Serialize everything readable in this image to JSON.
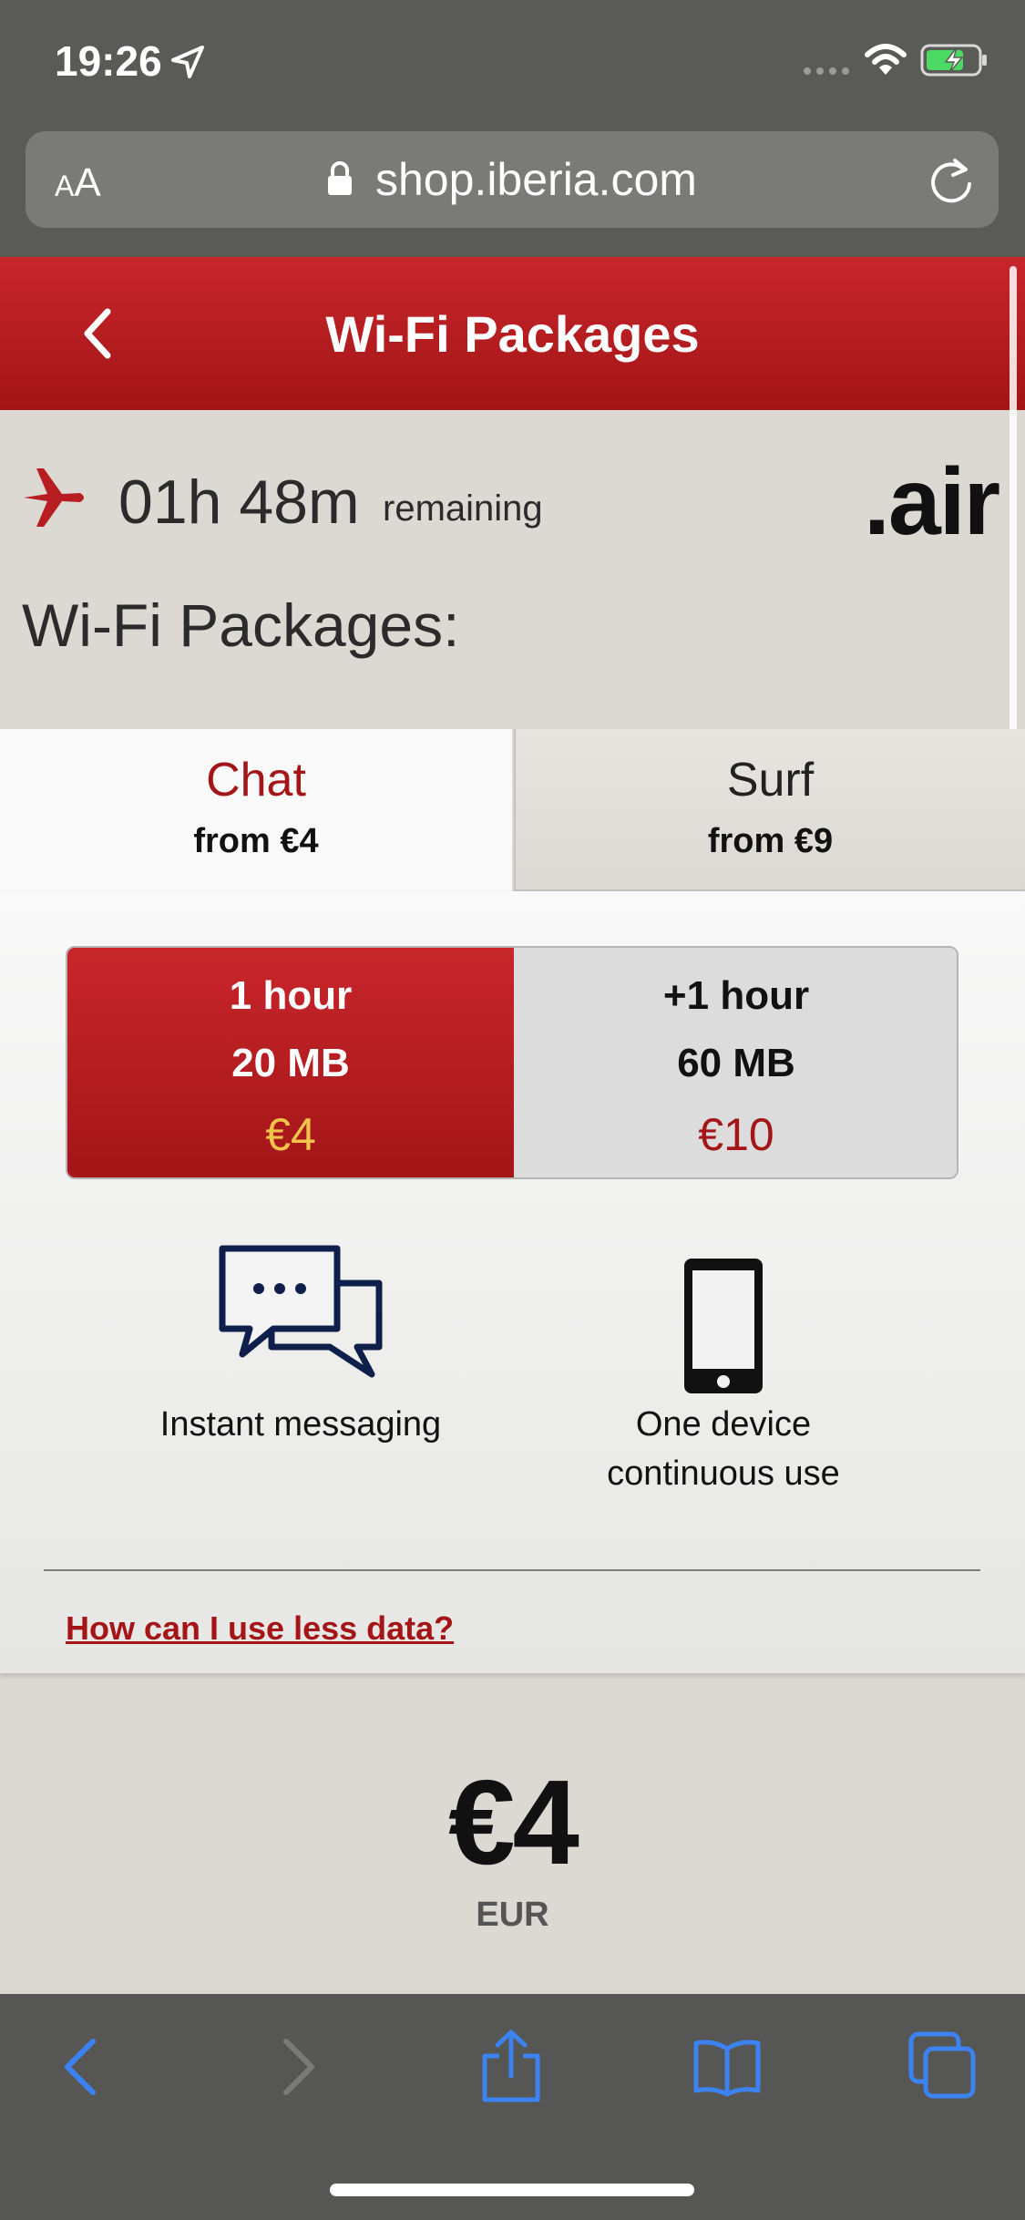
{
  "status_bar": {
    "time": "19:26"
  },
  "browser": {
    "text_size_small": "A",
    "text_size_large": "A",
    "url": "shop.iberia.com"
  },
  "header": {
    "title": "Wi-Fi Packages"
  },
  "flight": {
    "remaining_time": "01h 48m",
    "remaining_label": "remaining",
    "brand": ".air"
  },
  "packages_heading": "Wi-Fi Packages:",
  "tabs": [
    {
      "name": "Chat",
      "price": "from €4",
      "selected": true
    },
    {
      "name": "Surf",
      "price": "from €9",
      "selected": false
    }
  ],
  "options": [
    {
      "time": "1 hour",
      "data": "20 MB",
      "price": "€4",
      "selected": true
    },
    {
      "time": "+1 hour",
      "data": "60 MB",
      "price": "€10",
      "selected": false
    }
  ],
  "features": {
    "messaging": "Instant messaging",
    "device_line1": "One device",
    "device_line2": "continuous use"
  },
  "help_link": "How can I use less data?",
  "total": {
    "amount": "€4",
    "currency": "EUR"
  },
  "colors": {
    "brand_red": "#a31517",
    "accent_gold": "#f0c44c",
    "ios_blue": "#3c82f0"
  },
  "toolbar": {
    "icons": [
      "back-icon",
      "forward-icon",
      "share-icon",
      "bookmarks-icon",
      "tabs-icon"
    ]
  }
}
